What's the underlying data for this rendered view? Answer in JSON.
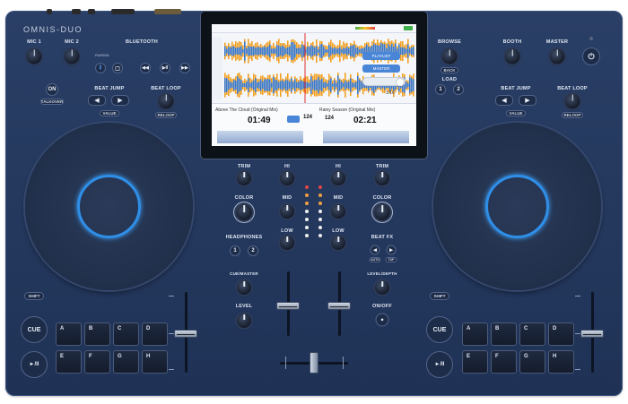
{
  "brand": "OMNIS-DUO",
  "left": {
    "mic1": "MIC 1",
    "mic2": "MIC 2",
    "bluetooth": "BLUETOOTH",
    "pairing": "PAIRING",
    "talkover_btn": "ON",
    "talkover": "TALKOVER",
    "beat_jump": "BEAT JUMP",
    "value": "VALUE",
    "beat_loop": "BEAT LOOP",
    "reloop": "RELOOP",
    "shift": "SHIFT",
    "cue": "CUE",
    "play": "►/II",
    "pads": [
      "A",
      "B",
      "C",
      "D",
      "E",
      "F",
      "G",
      "H"
    ]
  },
  "right": {
    "browse": "BROWSE",
    "back": "BACK",
    "load": "LOAD",
    "load1": "1",
    "load2": "2",
    "booth": "BOOTH",
    "master": "MASTER",
    "beat_jump": "BEAT JUMP",
    "value": "VALUE",
    "beat_loop": "BEAT LOOP",
    "reloop": "RELOOP",
    "shift": "SHIFT",
    "cue": "CUE",
    "play": "►/II",
    "pads": [
      "A",
      "B",
      "C",
      "D",
      "E",
      "F",
      "G",
      "H"
    ]
  },
  "mixer": {
    "trim": "TRIM",
    "hi": "HI",
    "mid": "MID",
    "low": "LOW",
    "color": "COLOR",
    "headphones": "HEADPHONES",
    "hp1": "1",
    "hp2": "2",
    "cue_master": "CUE/MASTER",
    "level": "LEVEL",
    "beat_fx": "BEAT FX",
    "auto": "AUTO",
    "tap": "TAP",
    "level_depth": "LEVEL/DEPTH",
    "on_off": "ON/OFF"
  },
  "screen": {
    "deck1_title": "Above The Cloud (Original Mix)",
    "deck1_time": "01:49",
    "deck1_bpm": "124",
    "deck2_title": "Rainy Season (Original Mix)",
    "deck2_time": "02:21",
    "deck2_bpm": "124",
    "btn_playlist": "PLAYLIST",
    "btn_master": "MASTER",
    "beat_value": "1/16"
  },
  "colors": {
    "body": "#243860",
    "jog_ring": "#2f8fe8",
    "wave_orange": "#f2a020",
    "wave_blue": "#3a78c8"
  }
}
